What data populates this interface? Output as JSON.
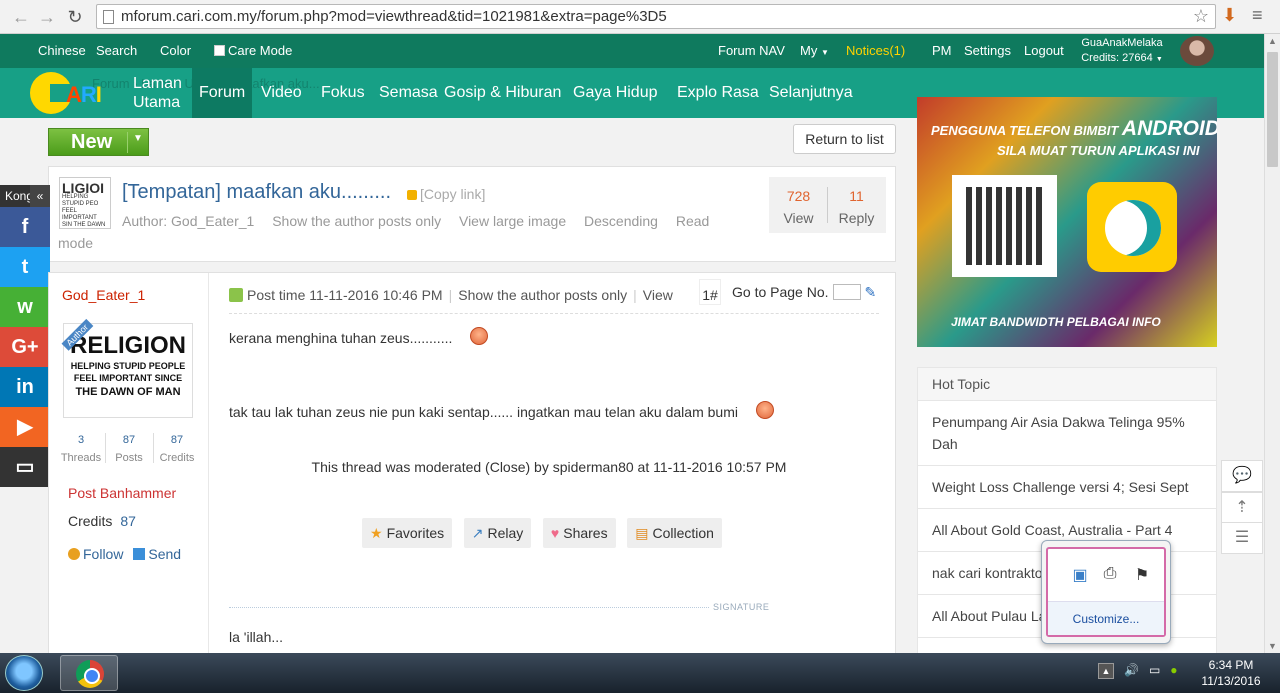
{
  "browser": {
    "url": "mforum.cari.com.my/forum.php?mod=viewthread&tid=1021981&extra=page%3D5"
  },
  "topbar": {
    "left": [
      "Chinese",
      "Search",
      "Color"
    ],
    "care_mode": "Care Mode",
    "forum_nav": "Forum NAV",
    "my": "My",
    "notices": "Notices(1)",
    "pm": "PM",
    "settings": "Settings",
    "logout": "Logout",
    "username": "GuaAnakMelaka",
    "credits": "Credits: 27664"
  },
  "nav": {
    "home_line1": "Laman",
    "home_line2": "Utama",
    "items": [
      "Forum",
      "Video",
      "Fokus",
      "Semasa",
      "Gosip & Hiburan",
      "Gaya Hidup",
      "Explo Rasa",
      "Selanjutnya"
    ],
    "ghost": "Forum › Laman Utama › maafkan aku..."
  },
  "buttons": {
    "new": "New",
    "return": "Return to list"
  },
  "thread": {
    "thumb_big": "LIGIOI",
    "thumb_small": "HELPING STUPID PEO FEEL IMPORTANT SIN THE DAWN OF MA",
    "title": "[Tempatan] maafkan aku.........",
    "copy_link": "[Copy link]",
    "author": "Author: God_Eater_1",
    "meta": [
      "Show the author posts only",
      "View large image",
      "Descending",
      "Read"
    ],
    "meta_wrap": "mode",
    "views": "728",
    "views_label": "View",
    "replies": "11",
    "replies_label": "Reply"
  },
  "share": {
    "label": "Kongsi",
    "chevron": "«",
    "buttons": [
      {
        "name": "facebook",
        "glyph": "f",
        "color": "#3b5998"
      },
      {
        "name": "twitter",
        "glyph": "t",
        "color": "#1da1f2"
      },
      {
        "name": "wechat",
        "glyph": "w",
        "color": "#46b035"
      },
      {
        "name": "googleplus",
        "glyph": "G+",
        "color": "#dd4b39"
      },
      {
        "name": "linkedin",
        "glyph": "in",
        "color": "#0077b5"
      },
      {
        "name": "video",
        "glyph": "▶",
        "color": "#f26522"
      },
      {
        "name": "comment",
        "glyph": "▭",
        "color": "#333333"
      }
    ]
  },
  "post": {
    "author": "God_Eater_1",
    "avatar_ribbon": "Author",
    "avatar_big": "RELIGION",
    "avatar_small": "HELPING STUPID PEOPLE FEEL IMPORTANT SINCE",
    "avatar_small2": "THE DAWN OF MAN",
    "threads": "3",
    "threads_label": "Threads",
    "posts": "87",
    "posts_label": "Posts",
    "credits_n": "87",
    "credits_label": "Credits",
    "rank": "Post Banhammer",
    "credits_text": "Credits",
    "credits_value": "87",
    "follow": "Follow",
    "send": "Send",
    "post_time": "Post time 11-11-2016 10:46 PM",
    "show_author": "Show the author posts only",
    "view": "View",
    "floor": "1#",
    "goto": "Go to Page No.",
    "line1": "kerana menghina tuhan zeus...........",
    "line2": "tak tau lak tuhan zeus nie pun kaki sentap...... ingatkan mau telan aku dalam bumi",
    "moderated": "This thread was moderated (Close) by spiderman80 at 11-11-2016 10:57 PM",
    "actions": [
      "Favorites",
      "Relay",
      "Shares",
      "Collection"
    ],
    "signature_label": "SIGNATURE",
    "signature": "la 'illah..."
  },
  "banner": {
    "line1a": "PENGGUNA TELEFON BIMBIT ",
    "line1b": "ANDROID",
    "line2": "SILA MUAT TURUN APLIKASI INI",
    "line3": "JIMAT BANDWIDTH   PELBAGAI INFO"
  },
  "hot": {
    "title": "Hot Topic",
    "items": [
      "Penumpang Air Asia Dakwa Telinga 95% Dah",
      "Weight Loss Challenge versi 4; Sesi Sept",
      "All About Gold Coast, Australia - Part 4",
      "nak cari kontraktor ... tap",
      "All About Pulau La..."
    ]
  },
  "tray": {
    "customize": "Customize..."
  },
  "taskbar": {
    "time": "6:34 PM",
    "date": "11/13/2016"
  }
}
